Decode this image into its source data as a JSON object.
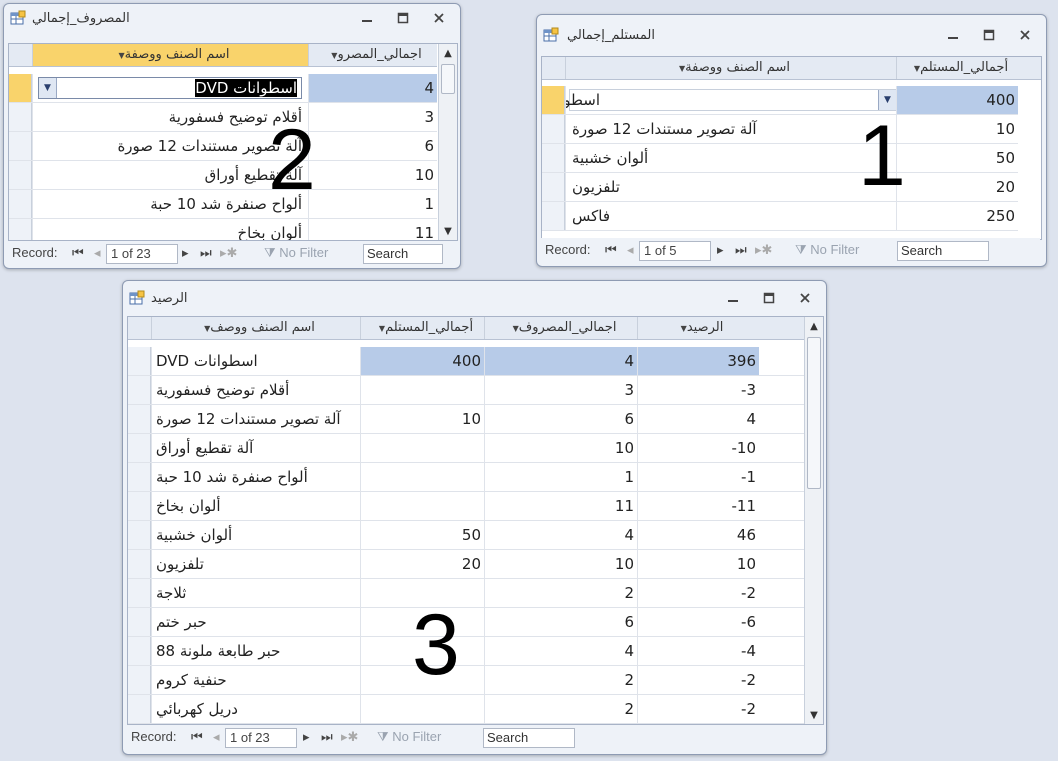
{
  "colors": {
    "selected_cell": "#b7cbe8",
    "current_header": "#f9d36b",
    "background": "#dde3ee"
  },
  "window1": {
    "title": "المستلم_إجمالي",
    "label_number": "1",
    "columns": [
      "اسم الصنف ووصفة",
      "أجمالي_المستلم"
    ],
    "rows": [
      {
        "name": "اسطوانات DVD",
        "received": "400"
      },
      {
        "name": "آلة تصوير مستندات 12 صورة",
        "received": "10"
      },
      {
        "name": "ألوان خشبية",
        "received": "50"
      },
      {
        "name": "تلفزيون",
        "received": "20"
      },
      {
        "name": "فاكس",
        "received": "250"
      }
    ],
    "nav": {
      "record_label": "Record:",
      "record_pos": "1 of 5",
      "no_filter": "No Filter",
      "search": "Search"
    }
  },
  "window2": {
    "title": "المصروف_إجمالي",
    "label_number": "2",
    "columns": [
      "اسم الصنف ووصفة",
      "اجمالي_المصرو"
    ],
    "rows": [
      {
        "name": "اسطوانات DVD",
        "spent": "4"
      },
      {
        "name": "أقلام توضيح فسفورية",
        "spent": "3"
      },
      {
        "name": "آلة تصوير مستندات 12 صورة",
        "spent": "6"
      },
      {
        "name": "آلة تقطيع أوراق",
        "spent": "10"
      },
      {
        "name": "ألواح صنفرة شد 10 حبة",
        "spent": "1"
      },
      {
        "name": "ألوان بخاخ",
        "spent": "11"
      }
    ],
    "nav": {
      "record_label": "Record:",
      "record_pos": "1 of 23",
      "no_filter": "No Filter",
      "search": "Search"
    }
  },
  "window3": {
    "title": "الرصيد",
    "label_number": "3",
    "columns": [
      "اسم الصنف ووصف",
      "أجمالي_المستلم",
      "اجمالي_المصروف",
      "الرصيد"
    ],
    "rows": [
      {
        "name": "اسطوانات DVD",
        "received": "400",
        "spent": "4",
        "balance": "396"
      },
      {
        "name": "أقلام توضيح فسفورية",
        "received": "",
        "spent": "3",
        "balance": "-3"
      },
      {
        "name": "آلة تصوير مستندات 12 صورة",
        "received": "10",
        "spent": "6",
        "balance": "4"
      },
      {
        "name": "آلة تقطيع أوراق",
        "received": "",
        "spent": "10",
        "balance": "-10"
      },
      {
        "name": "ألواح صنفرة شد 10 حبة",
        "received": "",
        "spent": "1",
        "balance": "-1"
      },
      {
        "name": "ألوان بخاخ",
        "received": "",
        "spent": "11",
        "balance": "-11"
      },
      {
        "name": "ألوان خشبية",
        "received": "50",
        "spent": "4",
        "balance": "46"
      },
      {
        "name": "تلفزيون",
        "received": "20",
        "spent": "10",
        "balance": "10"
      },
      {
        "name": "ثلاجة",
        "received": "",
        "spent": "2",
        "balance": "-2"
      },
      {
        "name": "حبر ختم",
        "received": "",
        "spent": "6",
        "balance": "-6"
      },
      {
        "name": "حبر طابعة ملونة 88",
        "received": "",
        "spent": "4",
        "balance": "-4"
      },
      {
        "name": "حنفية كروم",
        "received": "",
        "spent": "2",
        "balance": "-2"
      },
      {
        "name": "دريل كهربائي",
        "received": "",
        "spent": "2",
        "balance": "-2"
      }
    ],
    "nav": {
      "record_label": "Record:",
      "record_pos": "1 of 23",
      "no_filter": "No Filter",
      "search": "Search"
    }
  }
}
